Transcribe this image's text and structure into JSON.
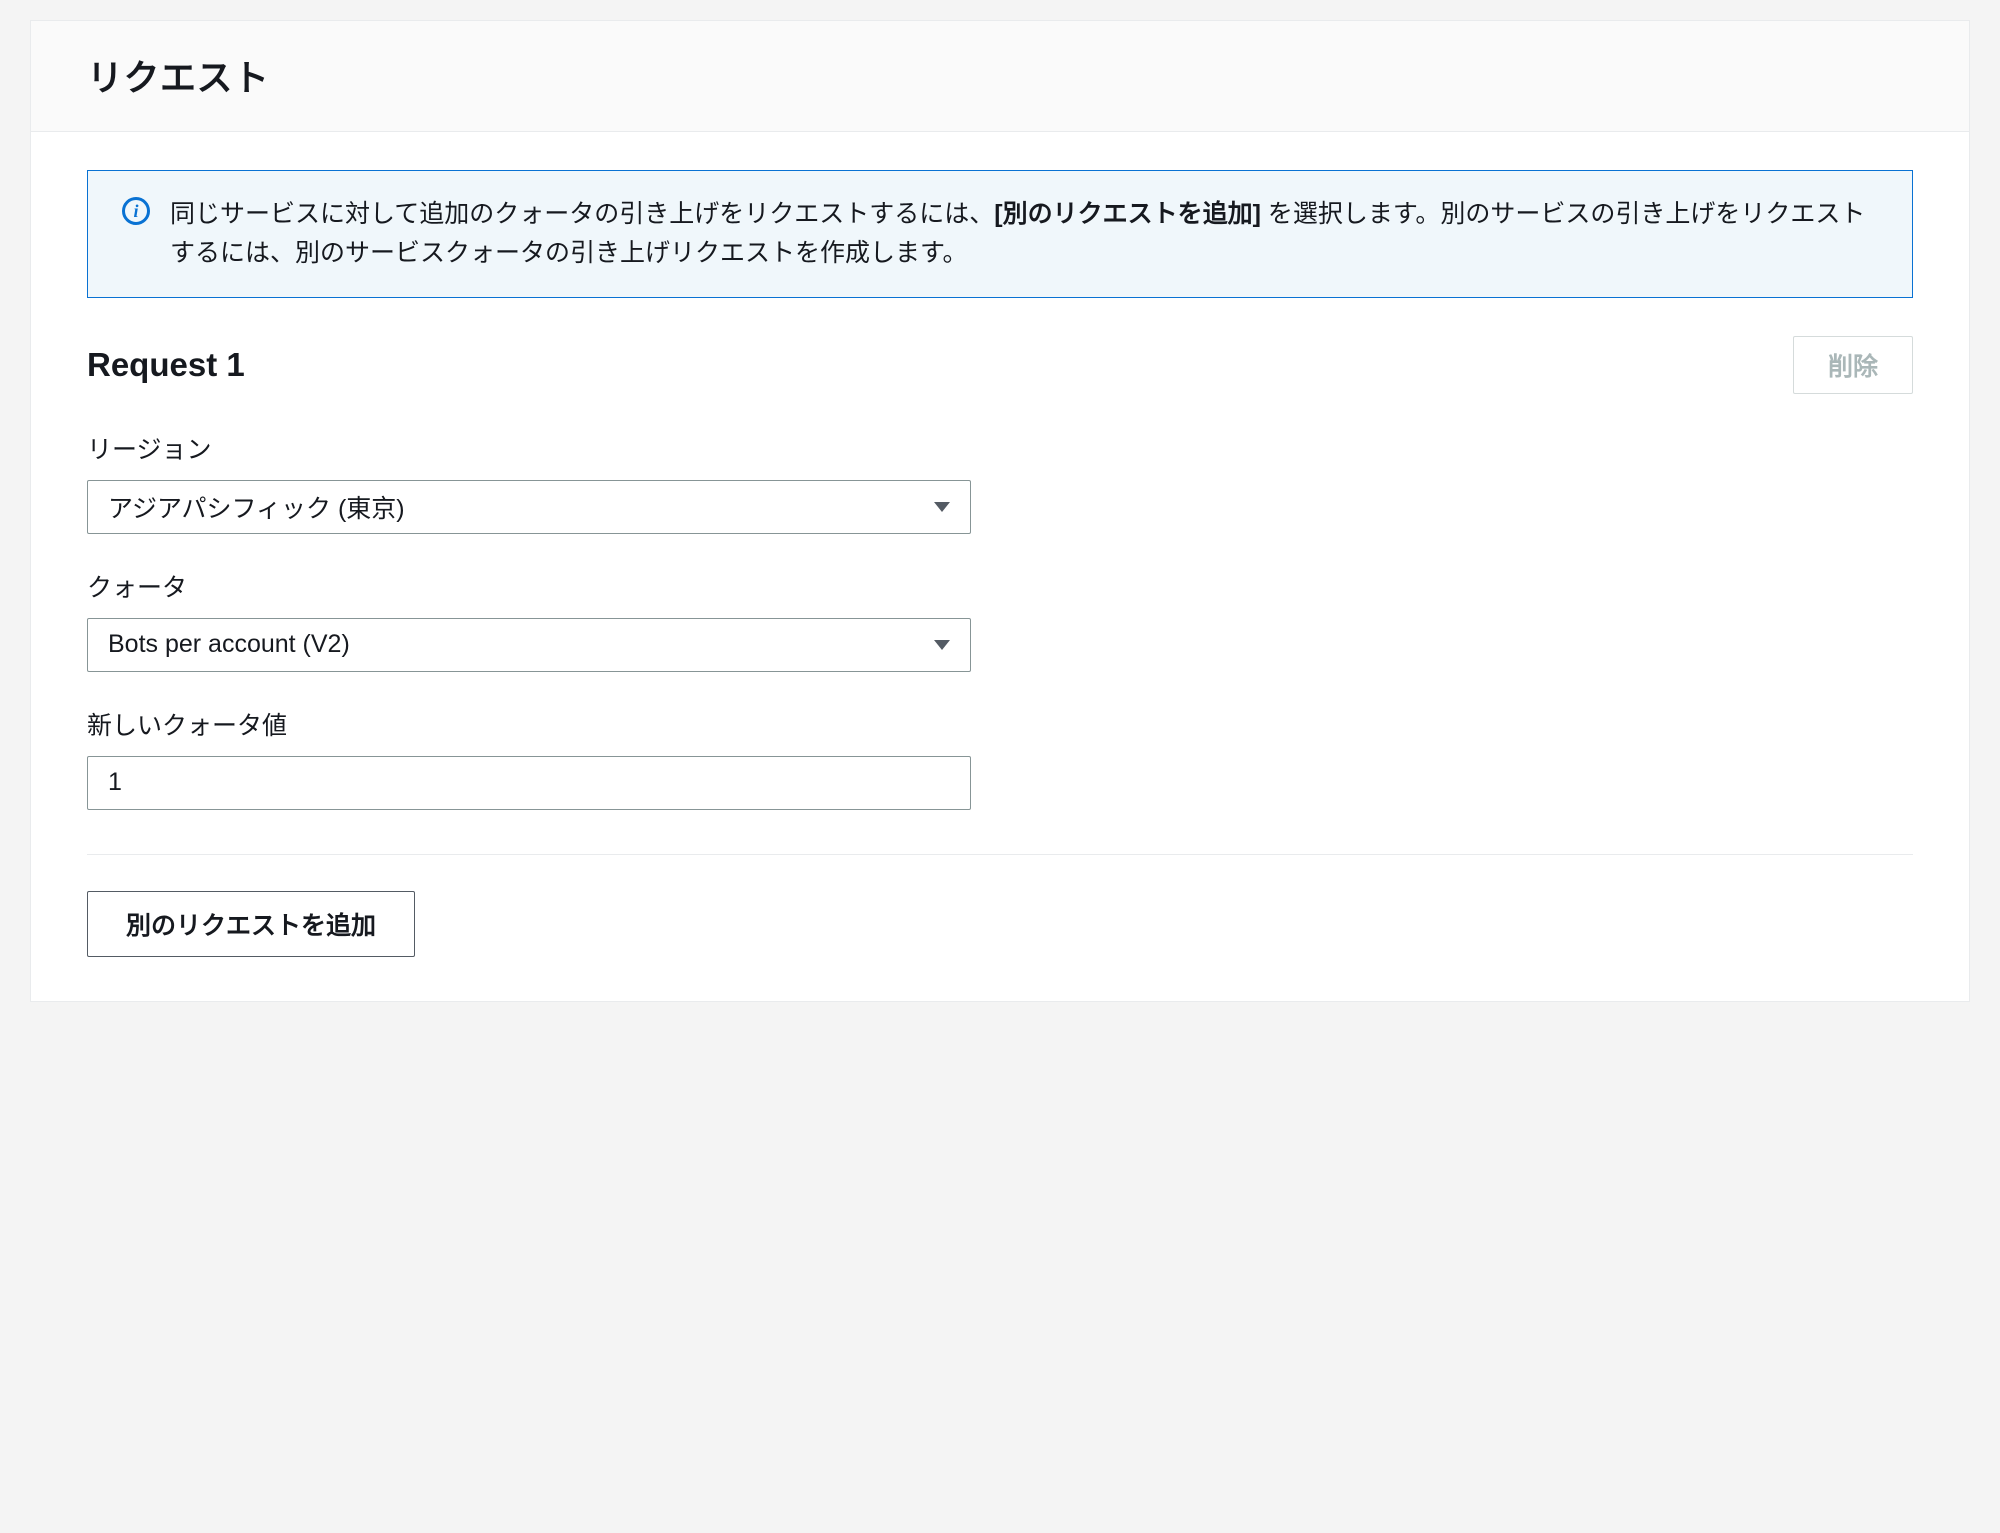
{
  "panel": {
    "title": "リクエスト"
  },
  "alert": {
    "text_prefix": "同じサービスに対して追加のクォータの引き上げをリクエストするには、",
    "text_bold": "[別のリクエストを追加]",
    "text_suffix": " を選択します。別のサービスの引き上げをリクエストするには、別のサービスクォータの引き上げリクエストを作成します。",
    "icon_glyph": "i"
  },
  "request": {
    "title": "Request 1",
    "delete_label": "削除",
    "fields": {
      "region": {
        "label": "リージョン",
        "value": "アジアパシフィック (東京)"
      },
      "quota": {
        "label": "クォータ",
        "value": "Bots per account (V2)"
      },
      "new_value": {
        "label": "新しいクォータ値",
        "value": "1"
      }
    }
  },
  "add_button": {
    "label": "別のリクエストを追加"
  }
}
